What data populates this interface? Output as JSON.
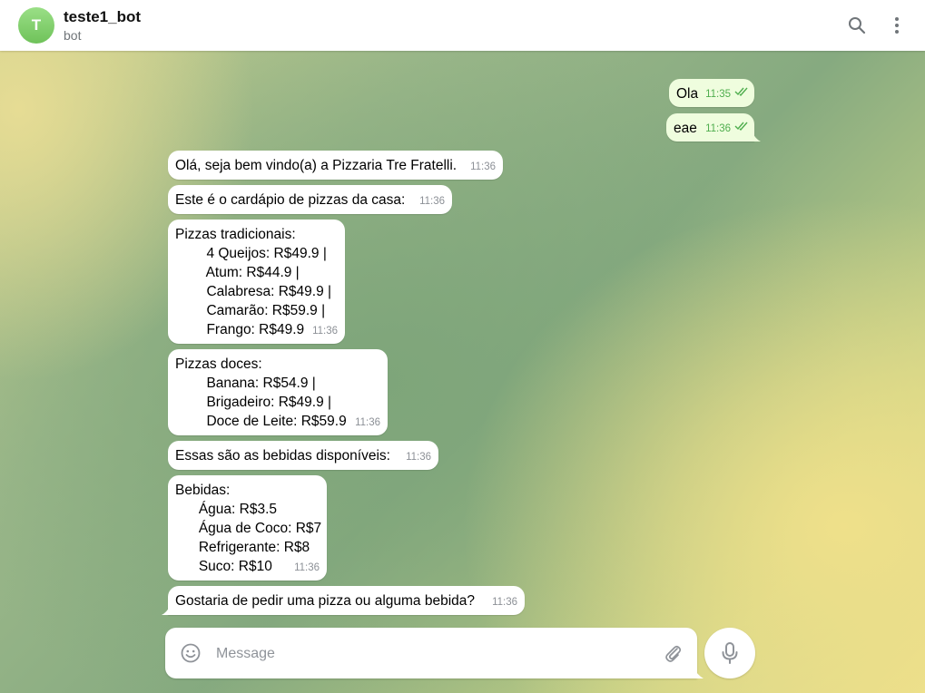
{
  "header": {
    "avatar_letter": "T",
    "title": "teste1_bot",
    "subtitle": "bot"
  },
  "messages": [
    {
      "dir": "out",
      "lines": [
        "Ola"
      ],
      "time": "11:35"
    },
    {
      "dir": "out",
      "lines": [
        "eae"
      ],
      "time": "11:36"
    },
    {
      "dir": "in",
      "lines": [
        "Olá, seja bem vindo(a) a Pizzaria Tre Fratelli."
      ],
      "time": "11:36"
    },
    {
      "dir": "in",
      "lines": [
        "Este é o cardápio de pizzas da casa:"
      ],
      "time": "11:36"
    },
    {
      "dir": "in",
      "lines": [
        "Pizzas tradicionais:",
        "        4 Queijos: R$49.9 |",
        "        Atum: R$44.9 |",
        "        Calabresa: R$49.9 |",
        "        Camarão: R$59.9 |",
        "        Frango: R$49.9"
      ],
      "time": "11:36"
    },
    {
      "dir": "in",
      "lines": [
        "Pizzas doces:",
        "        Banana: R$54.9 |",
        "        Brigadeiro: R$49.9 |",
        "        Doce de Leite: R$59.9"
      ],
      "time": "11:36"
    },
    {
      "dir": "in",
      "lines": [
        "Essas são as bebidas disponíveis:"
      ],
      "time": "11:36"
    },
    {
      "dir": "in",
      "lines": [
        "Bebidas:",
        "      Água: R$3.5",
        "      Água de Coco: R$7",
        "      Refrigerante: R$8",
        "      Suco: R$10"
      ],
      "time": "11:36"
    },
    {
      "dir": "in",
      "lines": [
        "Gostaria de pedir uma pizza ou alguma bebida?"
      ],
      "time": "11:36"
    }
  ],
  "composer": {
    "placeholder": "Message"
  },
  "colors": {
    "outgoing_bubble": "#effdde",
    "incoming_bubble": "#ffffff",
    "read_ticks": "#4fae4e",
    "avatar": "#7ccf68"
  }
}
